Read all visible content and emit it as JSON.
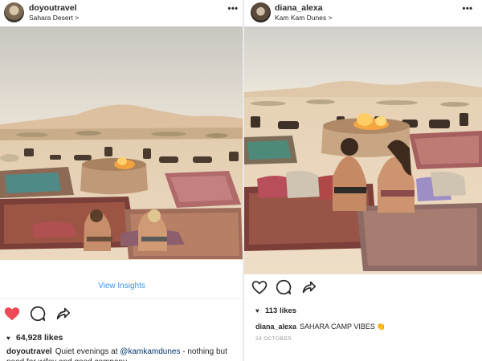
{
  "colors": {
    "like_red": "#ed4956",
    "link_blue": "#3897f0",
    "text": "#262626",
    "muted": "#999999"
  },
  "left_post": {
    "username": "doyoutravel",
    "location": "Sahara Desert",
    "location_chevron": ">",
    "more_label": "•••",
    "insights_label": "View Insights",
    "liked": true,
    "likes_text": "64,928 likes",
    "caption_user": "doyoutravel",
    "caption_pre": "Quiet evenings at",
    "caption_mention": "@kamkamdunes",
    "caption_post": "- nothing but need for wifey and good company",
    "icons": [
      "heart-filled-icon",
      "comment-icon",
      "share-icon",
      "more-icon"
    ]
  },
  "right_post": {
    "username": "diana_alexa",
    "location": "Kam Kam Dunes",
    "location_chevron": ">",
    "more_label": "•••",
    "liked": false,
    "likes_text": "113 likes",
    "caption_user": "diana_alexa",
    "caption_text": "SAHARA CAMP VIBES",
    "caption_emoji": "👏",
    "date": "28 OCTOBER",
    "icons": [
      "heart-outline-icon",
      "comment-icon",
      "share-icon",
      "more-icon"
    ]
  }
}
